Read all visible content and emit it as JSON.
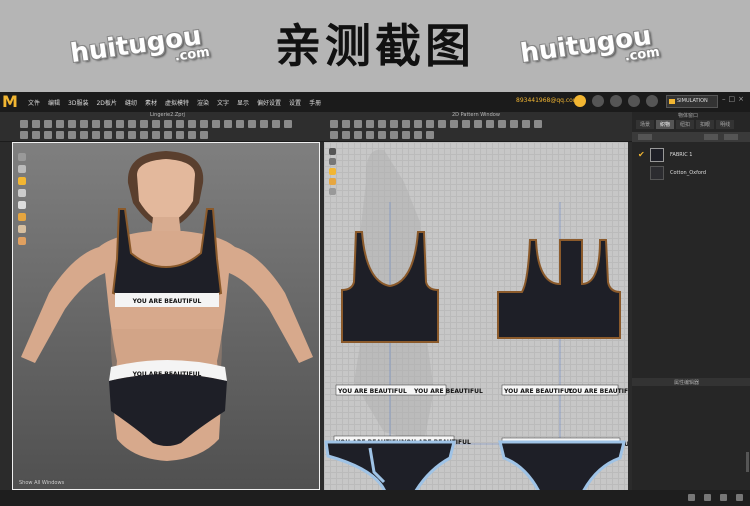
{
  "banner": {
    "title": "亲测截图",
    "watermark_main": "huitugou",
    "watermark_sub": ".com"
  },
  "app": {
    "logo": "M",
    "menu": [
      "文件",
      "编辑",
      "3D服装",
      "2D板片",
      "缝纫",
      "素材",
      "虚拟模特",
      "渲染",
      "文字",
      "显示",
      "偏好设置",
      "设置",
      "手册"
    ],
    "account": "893441968@qq.com",
    "mode": "SIMULATION",
    "tab_3d": "Lingerie2.Zprj",
    "tab_2d": "2D Pattern Window",
    "right_title": "物体窗口",
    "right_tabs": [
      "场景",
      "织物",
      "纽扣",
      "扣眼",
      "明线"
    ],
    "active_tab": "织物",
    "fabric_items": [
      {
        "name": "FABRIC 1",
        "checked": true
      },
      {
        "name": "Cotton_Oxford",
        "checked": false
      }
    ],
    "property_title": "属性编辑器",
    "status_3d": "Show All Windows",
    "band_text": "YOU ARE BEAUTIFUL",
    "colors": {
      "accent": "#f2b632",
      "garment": "#1e1f27",
      "trim": "#8b5a2b",
      "skin": "#d7a98c"
    }
  }
}
